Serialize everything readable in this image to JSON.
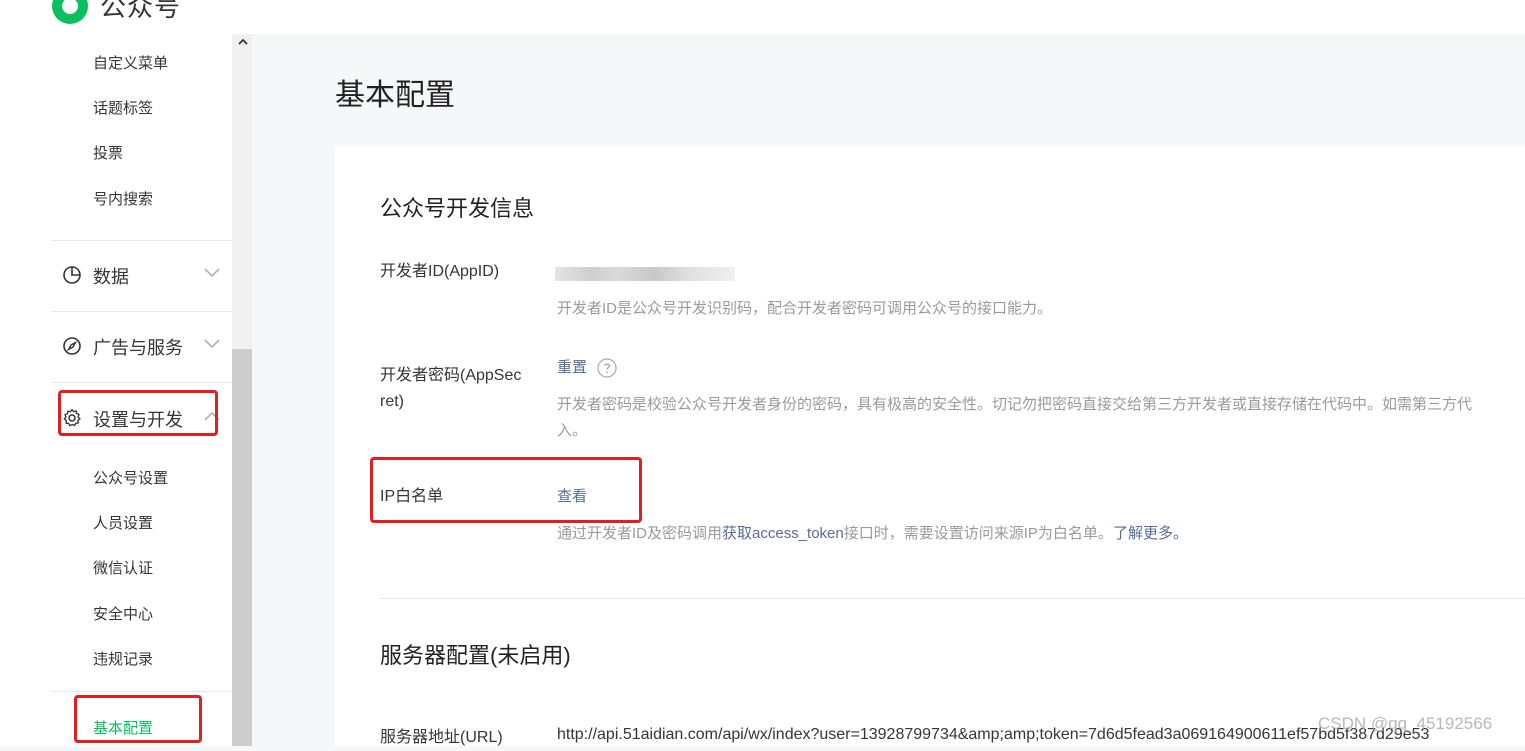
{
  "header": {
    "brand": "公众号"
  },
  "sidebar": {
    "top_items": [
      "自定义菜单",
      "话题标签",
      "投票",
      "号内搜索"
    ],
    "groups": [
      {
        "label": "数据",
        "icon": "pie-chart-icon",
        "expanded": false
      },
      {
        "label": "广告与服务",
        "icon": "compass-icon",
        "expanded": false
      },
      {
        "label": "设置与开发",
        "icon": "gear-icon",
        "expanded": true
      }
    ],
    "settings_items": [
      "公众号设置",
      "人员设置",
      "微信认证",
      "安全中心",
      "违规记录"
    ],
    "active_item": "基本配置",
    "accent_color": "#07c160"
  },
  "main": {
    "title": "基本配置",
    "dev_info": {
      "heading": "公众号开发信息",
      "appid_label": "开发者ID(AppID)",
      "appid_desc": "开发者ID是公众号开发识别码，配合开发者密码可调用公众号的接口能力。",
      "secret_label_line1": "开发者密码(AppSec",
      "secret_label_line2": "ret)",
      "reset_link": "重置",
      "secret_desc_line1": "开发者密码是校验公众号开发者身份的密码，具有极高的安全性。切记勿把密码直接交给第三方开发者或直接存储在代码中。如需第三方代",
      "secret_desc_line2": "入。",
      "ip_label": "IP白名单",
      "ip_link": "查看",
      "ip_desc_pre": "通过开发者ID及密码调用",
      "ip_desc_link": "获取access_token",
      "ip_desc_mid": "接口时，需要设置访问来源IP为白名单。",
      "ip_desc_more": "了解更多。"
    },
    "server": {
      "heading": "服务器配置(未启用)",
      "url_label": "服务器地址(URL)",
      "url_value": "http://api.51aidian.com/api/wx/index?user=13928799734&amp;amp;token=7d6d5fead3a069164900611ef57bd5f387d29e53"
    }
  },
  "watermark": "CSDN @qq_45192566",
  "colors": {
    "link": "#576b95",
    "highlight_box": "#e02020"
  }
}
